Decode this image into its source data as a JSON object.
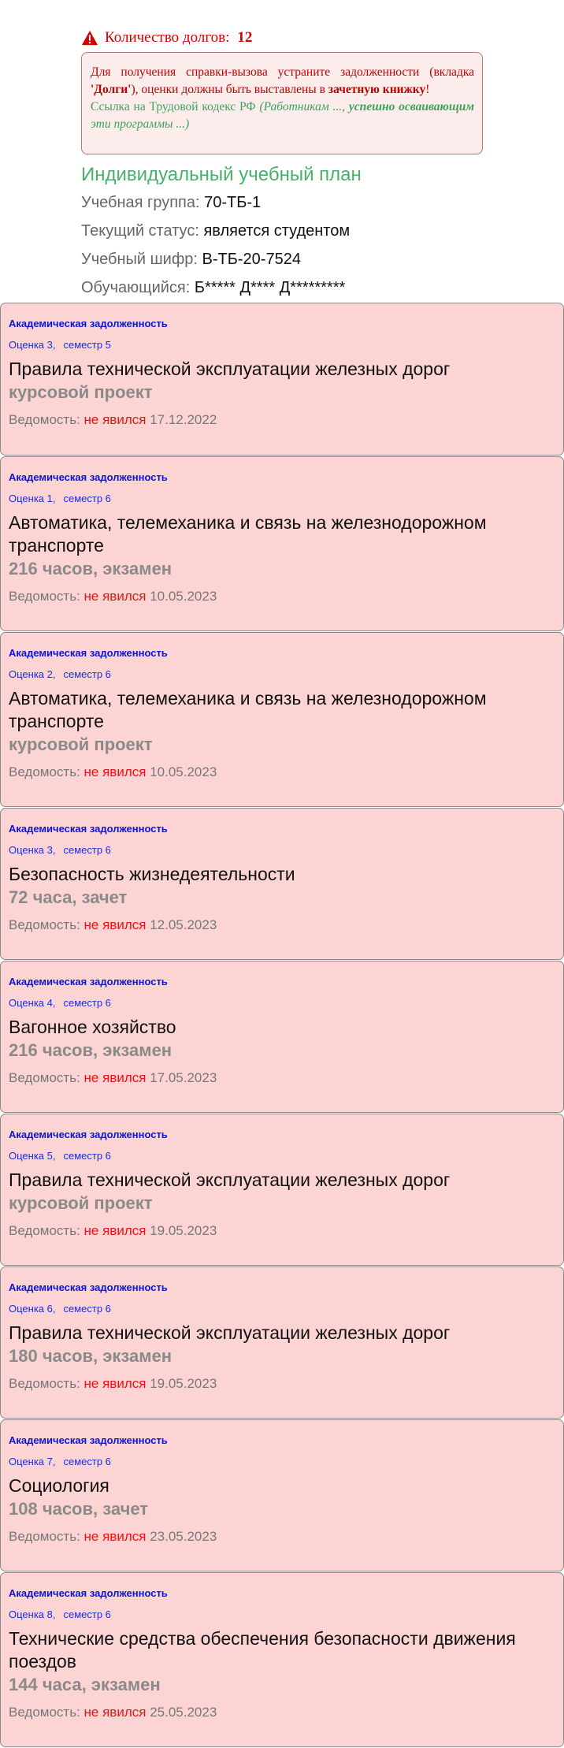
{
  "header": {
    "debt_label": "Количество долгов:",
    "debt_count": "12",
    "notice": {
      "line1": "Для получения справки-вызова устраните задолженности (вкладка ",
      "tab_name": "'Долги'",
      "line1b": "), оценки должны быть выставлены в ",
      "gradebook": "зачетную книжку",
      "exclaim": "!",
      "link_text": "Ссылка на Трудовой кодекс РФ ",
      "link_italic_a": "(Работникам ..., ",
      "link_bold": "успешно осваивающим",
      "link_italic_b": " эти программы ...)"
    },
    "plan_title": "Индивидуальный учебный план",
    "info": [
      {
        "label": "Учебная группа: ",
        "value": "70-ТБ-1"
      },
      {
        "label": "Текущий статус: ",
        "value": "является студентом"
      },
      {
        "label": "Учебный шифр: ",
        "value": "В-ТБ-20-7524"
      },
      {
        "label": "Обучающийся: ",
        "value": "Б***** Д**** Д*********"
      }
    ]
  },
  "card_type_label": "Академическая задолженность",
  "ved_label": "Ведомость: ",
  "absent_label": "не явился",
  "cards": [
    {
      "grade": "Оценка 3,",
      "semester": "семестр 5",
      "title": "Правила технической эксплуатации железных дорог",
      "subtitle": "курсовой проект",
      "date": " 17.12.2022"
    },
    {
      "grade": "Оценка 1,",
      "semester": "семестр 6",
      "title": "Автоматика, телемеханика и связь на железнодорожном транспорте",
      "subtitle": "216 часов, экзамен",
      "date": " 10.05.2023"
    },
    {
      "grade": "Оценка 2,",
      "semester": "семестр 6",
      "title": "Автоматика, телемеханика и связь на железнодорожном транспорте",
      "subtitle": "курсовой проект",
      "date": " 10.05.2023"
    },
    {
      "grade": "Оценка 3,",
      "semester": "семестр 6",
      "title": "Безопасность жизнедеятельности",
      "subtitle": "72 часа, зачет",
      "date": " 12.05.2023"
    },
    {
      "grade": "Оценка 4,",
      "semester": "семестр 6",
      "title": "Вагонное хозяйство",
      "subtitle": "216 часов, экзамен",
      "date": " 17.05.2023"
    },
    {
      "grade": "Оценка 5,",
      "semester": "семестр 6",
      "title": "Правила технической эксплуатации железных дорог",
      "subtitle": "курсовой проект",
      "date": " 19.05.2023"
    },
    {
      "grade": "Оценка 6,",
      "semester": "семестр 6",
      "title": "Правила технической эксплуатации железных дорог",
      "subtitle": "180 часов, экзамен",
      "date": " 19.05.2023"
    },
    {
      "grade": "Оценка 7,",
      "semester": "семестр 6",
      "title": "Социология",
      "subtitle": "108 часов, зачет",
      "date": " 23.05.2023"
    },
    {
      "grade": "Оценка 8,",
      "semester": "семестр 6",
      "title": "Технические средства обеспечения безопасности движения поездов",
      "subtitle": "144 часа, экзамен",
      "date": " 25.05.2023"
    }
  ]
}
